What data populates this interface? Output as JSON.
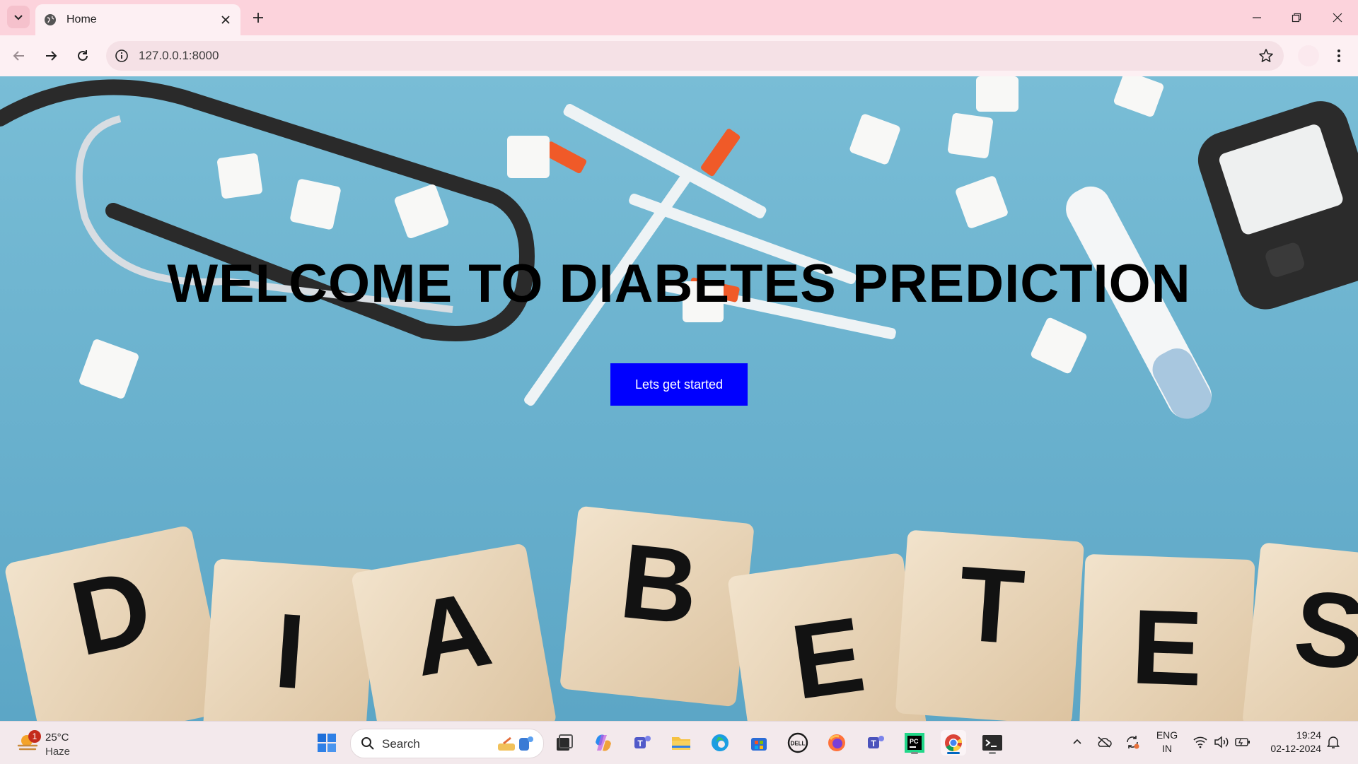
{
  "browser": {
    "tab": {
      "title": "Home"
    },
    "address_bar": {
      "url": "127.0.0.1:8000"
    }
  },
  "page": {
    "heading": "WELCOME TO DIABETES PREDICTION",
    "cta_label": "Lets get started",
    "background_tiles": [
      "D",
      "I",
      "A",
      "B",
      "E",
      "T",
      "E",
      "S"
    ]
  },
  "taskbar": {
    "weather": {
      "temperature": "25°C",
      "condition": "Haze",
      "badge": "1"
    },
    "search_placeholder": "Search",
    "pinned_apps": [
      "start",
      "search",
      "task-view",
      "copilot",
      "teams",
      "file-explorer",
      "edge",
      "microsoft-store",
      "dell",
      "firefox",
      "teams-work",
      "pycharm",
      "chrome",
      "terminal"
    ],
    "tray": {
      "language_line1": "ENG",
      "language_line2": "IN",
      "time": "19:24",
      "date": "02-12-2024"
    }
  },
  "colors": {
    "tabstrip": "#fcd3dc",
    "toolbar": "#fdf0f3",
    "page_background": "#6bb4cf",
    "cta_background": "#0000ff",
    "cta_text": "#ffffff",
    "taskbar": "#f3e9ec"
  }
}
